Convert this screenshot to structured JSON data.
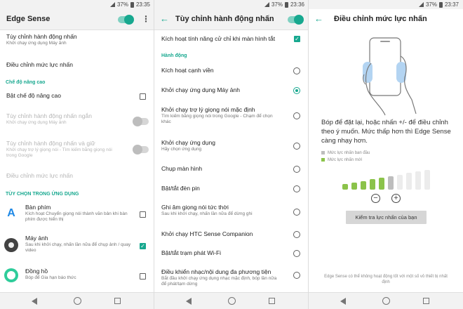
{
  "status_bar": {
    "screen1": {
      "battery": "37%",
      "time": "23:35"
    },
    "screen2": {
      "battery": "37%",
      "time": "23:36"
    },
    "screen3": {
      "battery": "37%",
      "time": "23:37"
    }
  },
  "screen1": {
    "title": "Edge Sense",
    "master_toggle": "on",
    "items": [
      {
        "title": "Tùy chỉnh hành động nhấn",
        "subtitle": "Khởi chạy ứng dụng Máy ảnh"
      },
      {
        "title": "Điều chỉnh mức lực nhấn"
      }
    ],
    "advanced_header": "Chế độ nâng cao",
    "advanced_toggle": "Bật chế độ nâng cao",
    "disabled_items": [
      {
        "title": "Tùy chỉnh hành động nhấn ngắn",
        "subtitle": "Khởi chạy ứng dụng Máy ảnh"
      },
      {
        "title": "Tùy chỉnh hành động nhấn và giữ",
        "subtitle": "Khởi chạy trợ lý giọng nói - Tìm kiếm bằng giọng nói trong Google"
      },
      {
        "title": "Điều chỉnh mức lực nhấn"
      }
    ],
    "app_options_header": "TÙY CHỌN TRONG ỨNG DỤNG",
    "apps": [
      {
        "name": "Bàn phím",
        "subtitle": "Kích hoạt Chuyển giọng nói thành văn bản khi bàn phím được hiển thị",
        "checked": false,
        "color": "#ffffff",
        "icon": "keyboard-icon"
      },
      {
        "name": "Máy ảnh",
        "subtitle": "Sau khi khởi chạy, nhấn lần nữa để chụp ảnh / quay video",
        "checked": true,
        "color": "#424242",
        "icon": "camera-icon"
      },
      {
        "name": "Đồng hồ",
        "subtitle": "Bóp để Gia hạn báo thức",
        "checked": false,
        "color": "#2ecc9a",
        "icon": "clock-icon"
      }
    ]
  },
  "screen2": {
    "title": "Tùy chỉnh hành động nhấn",
    "toggle": "on",
    "lock_screen": {
      "title": "Kích hoạt tính năng cử chỉ khi màn hình tắt",
      "checked": true
    },
    "actions_header": "Hành động",
    "actions": [
      {
        "title": "Kích hoạt cạnh viền",
        "selected": false
      },
      {
        "title": "Khởi chạy ứng dụng Máy ảnh",
        "selected": true
      },
      {
        "title": "Khởi chạy trợ lý giọng nói mặc định",
        "subtitle": "Tìm kiếm bằng giọng nói trong Google - Chạm để chọn khác",
        "selected": false
      },
      {
        "title": "Khởi chạy ứng dụng",
        "subtitle": "Hãy chọn ứng dụng",
        "selected": false
      },
      {
        "title": "Chụp màn hình",
        "selected": false
      },
      {
        "title": "Bật/tắt đèn pin",
        "selected": false
      },
      {
        "title": "Ghi âm giọng nói tức thời",
        "subtitle": "Sau khi khởi chạy, nhấn lần nữa để dừng ghi",
        "selected": false
      },
      {
        "title": "Khởi chạy HTC Sense Companion",
        "selected": false
      },
      {
        "title": "Bật/tắt trạm phát Wi-Fi",
        "selected": false
      },
      {
        "title": "Điều khiển nhạc/nội dung đa phương tiện",
        "subtitle": "Bắt đầu khởi chạy ứng dụng nhạc mặc định, bóp lần nữa để phát/tạm dừng",
        "selected": false
      }
    ]
  },
  "screen3": {
    "title": "Điều chỉnh mức lực nhấn",
    "instruction": "Bóp để đặt lại, hoặc nhấn +/- để điều chỉnh theo ý muốn. Mức thấp hơn thì Edge Sense càng nhạy hơn.",
    "legend": [
      {
        "label": "Mức lực nhấn ban đầu",
        "color": "#bdbdbd"
      },
      {
        "label": "Mức lực nhấn mới",
        "color": "#8bc34a"
      }
    ],
    "levels_total": 10,
    "level_new": 5,
    "level_initial": 6,
    "test_button": "Kiểm tra lực nhấn của bạn",
    "footnote": "Edge Sense có thể không hoạt động tốt với một số vỏ thiết bị nhất định"
  },
  "colors": {
    "accent": "#17a88f",
    "bar_active": "#8bc34a",
    "bar_initial": "#bdbdbd",
    "bar_inactive": "#ececec"
  }
}
